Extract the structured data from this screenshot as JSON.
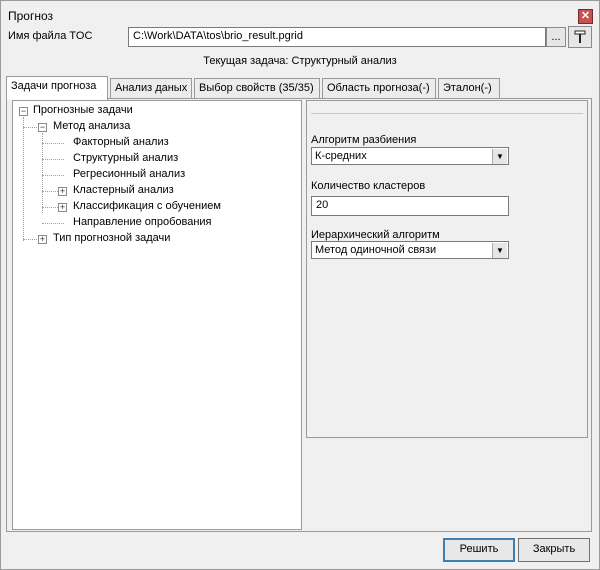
{
  "window": {
    "title": "Прогноз",
    "close_glyph": "✕"
  },
  "file": {
    "label": "Имя файла TOC",
    "path": "C:\\Work\\DATA\\tos\\brio_result.pgrid",
    "browse_label": "...",
    "pin_icon": "pin-icon"
  },
  "current_task": "Текущая задача: Структурный анализ",
  "tabs": [
    {
      "label": "Задачи прогноза",
      "active": true
    },
    {
      "label": "Анализ даных",
      "active": false
    },
    {
      "label": "Выбор свойств (35/35)",
      "active": false
    },
    {
      "label": "Область прогноза(-)",
      "active": false
    },
    {
      "label": "Эталон(-)",
      "active": false
    }
  ],
  "tree": {
    "root": {
      "label": "Прогнозные задачи",
      "toggle": "−"
    },
    "method": {
      "label": "Метод анализа",
      "toggle": "−"
    },
    "items": [
      {
        "label": "Факторный анализ",
        "toggle": ""
      },
      {
        "label": "Структурный анализ",
        "toggle": ""
      },
      {
        "label": "Регресионный анализ",
        "toggle": ""
      },
      {
        "label": "Кластерный анализ",
        "toggle": "+"
      },
      {
        "label": "Классификация с обучением",
        "toggle": "+"
      },
      {
        "label": "Направление опробования",
        "toggle": ""
      }
    ],
    "type_node": {
      "label": "Тип прогнозной задачи",
      "toggle": "+"
    }
  },
  "props": {
    "partition_label": "Алгоритм разбиения",
    "partition_value": "К-средних",
    "clusters_label": "Количество кластеров",
    "clusters_value": "20",
    "hier_label": "Иерархический алгоритм",
    "hier_value": "Метод одиночной связи",
    "dropdown_glyph": "▼"
  },
  "buttons": {
    "solve": "Решить",
    "close": "Закрыть"
  }
}
